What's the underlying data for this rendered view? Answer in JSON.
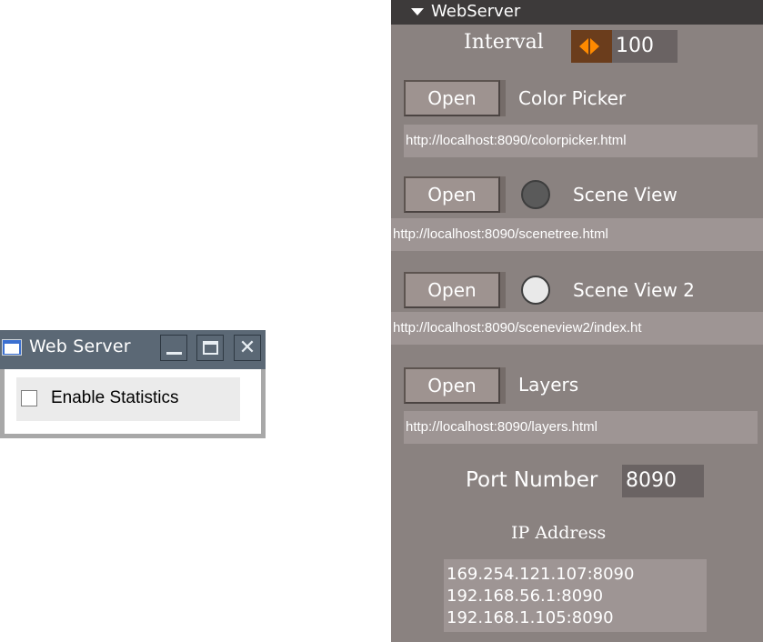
{
  "small_window": {
    "title": "Web Server",
    "controls": [
      "minimize",
      "maximize",
      "close"
    ],
    "close_glyph": "✕",
    "checkbox": {
      "label": "Enable Statistics",
      "checked": false
    }
  },
  "panel": {
    "title": "WebServer",
    "interval": {
      "label": "Interval",
      "value": "100"
    },
    "items": [
      {
        "button": "Open",
        "label": "Color Picker",
        "url": "http://localhost:8090/colorpicker.html",
        "indicator": "none"
      },
      {
        "button": "Open",
        "label": "Scene View",
        "url": "http://localhost:8090/scenetree.html",
        "indicator": "dark"
      },
      {
        "button": "Open",
        "label": "Scene View 2",
        "url": "http://localhost:8090/sceneview2/index.ht",
        "indicator": "light"
      },
      {
        "button": "Open",
        "label": "Layers",
        "url": "http://localhost:8090/layers.html",
        "indicator": "none"
      }
    ],
    "port": {
      "label": "Port Number",
      "value": "8090"
    },
    "ip": {
      "label": "IP Address",
      "addresses": [
        "169.254.121.107:8090",
        "192.168.56.1:8090",
        "192.168.1.105:8090"
      ]
    },
    "colors": {
      "panel_bg": "#8a8280",
      "header_bg": "#3d3a3a",
      "accent": "#ff8a00"
    }
  }
}
